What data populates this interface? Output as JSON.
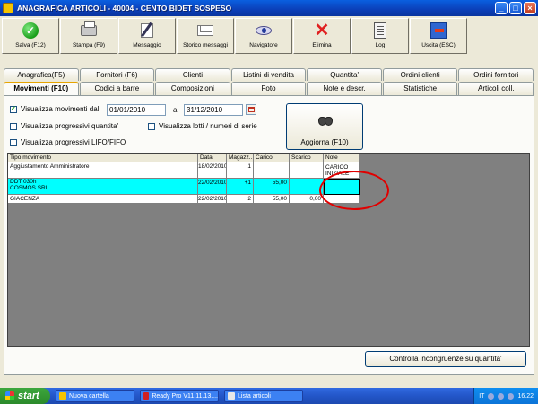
{
  "window": {
    "title": "ANAGRAFICA ARTICOLI - 40004 - CENTO BIDET SOSPESO",
    "min": "_",
    "max": "□",
    "close": "×"
  },
  "toolbar": [
    {
      "name": "save-button",
      "icon": "check-icon",
      "label": "Salva (F12)"
    },
    {
      "name": "print-button",
      "icon": "printer-icon",
      "label": "Stampa (F9)"
    },
    {
      "name": "message-button",
      "icon": "pen-icon",
      "label": "Messaggio"
    },
    {
      "name": "message-history-button",
      "icon": "mail-icon",
      "label": "Storico messaggi"
    },
    {
      "name": "navigator-button",
      "icon": "eye-icon",
      "label": "Navigatore"
    },
    {
      "name": "delete-button",
      "icon": "x-icon",
      "label": "Elimina"
    },
    {
      "name": "log-button",
      "icon": "log-icon",
      "label": "Log"
    },
    {
      "name": "exit-button",
      "icon": "exit-icon",
      "label": "Uscita (ESC)"
    }
  ],
  "tabs_row1": [
    "Anagrafica(F5)",
    "Fornitori (F6)",
    "Clienti",
    "Listini di vendita",
    "Quantita'",
    "Ordini clienti",
    "Ordini fornitori"
  ],
  "tabs_row2": [
    "Movimenti (F10)",
    "Codici a barre",
    "Composizioni",
    "Foto",
    "Note e descr.",
    "Statistiche",
    "Articoli coll."
  ],
  "active_tab": "Movimenti (F10)",
  "filters": {
    "show_movements_label": "Visualizza movimenti dal",
    "show_movements_checked": true,
    "date_from": "01/01/2010",
    "to_label": "al",
    "date_to": "31/12/2010",
    "progressive_qty_label": "Visualizza progressivi quantita'",
    "lots_label": "Visualizza lotti / numeri di serie",
    "lifo_label": "Visualizza progressivi LIFO/FIFO"
  },
  "refresh_button": {
    "label": "Aggiorna (F10)",
    "icon": "binoculars-icon"
  },
  "grid": {
    "columns": [
      "Tipo movimento",
      "Data",
      "Magazz...",
      "Carico",
      "Scarico",
      "Note"
    ],
    "rows": [
      {
        "tipo": [
          "Aggiustamento Amministratore"
        ],
        "data": "18/02/2010",
        "magazz": "1",
        "carico": "",
        "scarico": "",
        "note": "CARICO INIZIALE",
        "selected": false
      },
      {
        "tipo": [
          "DDT 030h",
          "COSMOS SRL"
        ],
        "data": "22/02/2010",
        "magazz": "+1",
        "carico": "55,00",
        "scarico": "",
        "note": "",
        "selected": true
      },
      {
        "tipo": [
          "GIACENZA"
        ],
        "data": "22/02/2010",
        "magazz": "2",
        "carico": "55,00",
        "scarico": "0,00",
        "note": "",
        "selected": false
      }
    ]
  },
  "check_button": {
    "label": "Controlla incongruenze su quantita'"
  },
  "taskbar": {
    "start": "start",
    "tasks": [
      "Nuova cartella",
      "Ready Pro V11.11.13....",
      "Lista articoli"
    ],
    "lang": "IT",
    "clock": "16.22"
  }
}
